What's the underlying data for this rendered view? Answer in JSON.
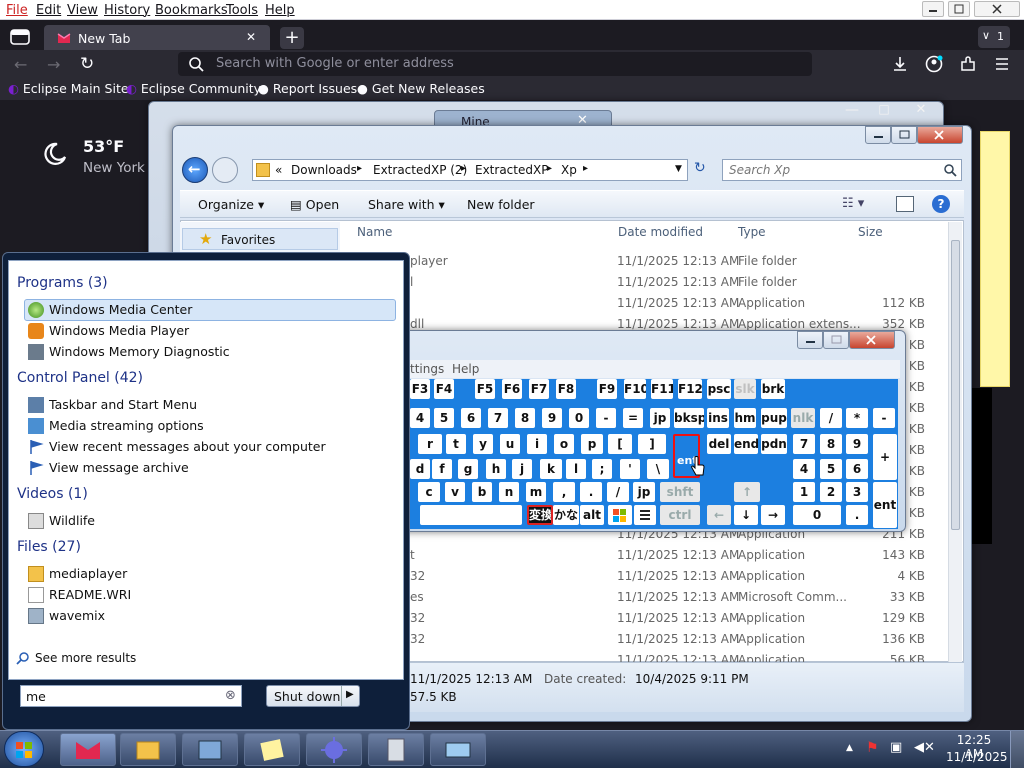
{
  "firefox": {
    "menubar": [
      "File",
      "Edit",
      "View",
      "History",
      "Bookmarks",
      "Tools",
      "Help"
    ],
    "tab": {
      "title": "New Tab",
      "close": "✕"
    },
    "tab_count_badge": "1",
    "search_placeholder": "Search with Google or enter address",
    "bookmarks": [
      "Eclipse Main Site",
      "Eclipse Community",
      "Report Issues",
      "Get New Releases"
    ],
    "weather": {
      "temp": "53°F",
      "city": "New York"
    }
  },
  "background_window_title": "Mine",
  "explorer": {
    "breadcrumb": {
      "prefix": "«",
      "items": [
        "Downloads",
        "ExtractedXP (2)",
        "ExtractedXP",
        "Xp"
      ]
    },
    "search_placeholder": "Search Xp",
    "toolbar": {
      "organize": "Organize",
      "open": "Open",
      "share": "Share with",
      "new_folder": "New folder"
    },
    "nav_favorites": "Favorites",
    "columns": [
      "Name",
      "Date modified",
      "Type",
      "Size"
    ],
    "rows": [
      {
        "name": "player",
        "date": "11/1/2025 12:13 AM",
        "type": "File folder",
        "size": ""
      },
      {
        "name": "l",
        "date": "11/1/2025 12:13 AM",
        "type": "File folder",
        "size": ""
      },
      {
        "name": "",
        "date": "11/1/2025 12:13 AM",
        "type": "Application",
        "size": "112 KB"
      },
      {
        "name": "dll",
        "date": "11/1/2025 12:13 AM",
        "type": "Application extens...",
        "size": "352 KB"
      },
      {
        "name": "rd",
        "date": "",
        "type": "",
        "size": "KB"
      },
      {
        "name": "",
        "date": "",
        "type": "",
        "size": "KB"
      },
      {
        "name": "",
        "date": "",
        "type": "",
        "size": "KB"
      },
      {
        "name": "",
        "date": "",
        "type": "",
        "size": "KB"
      },
      {
        "name": "",
        "date": "",
        "type": "",
        "size": "KB"
      },
      {
        "name": "",
        "date": "",
        "type": "",
        "size": "KB"
      },
      {
        "name": "",
        "date": "",
        "type": "",
        "size": "KB"
      },
      {
        "name": "",
        "date": "",
        "type": "",
        "size": "KB"
      },
      {
        "name": "",
        "date": "",
        "type": "",
        "size": "KB"
      },
      {
        "name": "",
        "date": "11/1/2025 12:13 AM",
        "type": "Application",
        "size": "211 KB"
      },
      {
        "name": "t",
        "date": "11/1/2025 12:13 AM",
        "type": "Application",
        "size": "143 KB"
      },
      {
        "name": "32",
        "date": "11/1/2025 12:13 AM",
        "type": "Application",
        "size": "4 KB"
      },
      {
        "name": "es",
        "date": "11/1/2025 12:13 AM",
        "type": "Microsoft Comm...",
        "size": "33 KB"
      },
      {
        "name": "32",
        "date": "11/1/2025 12:13 AM",
        "type": "Application",
        "size": "129 KB"
      },
      {
        "name": "32",
        "date": "11/1/2025 12:13 AM",
        "type": "Application",
        "size": "136 KB"
      },
      {
        "name": "",
        "date": "11/1/2025 12:13 AM",
        "type": "Application",
        "size": "56 KB"
      }
    ],
    "details": {
      "modified": "11/1/2025 12:13 AM",
      "created_label": "Date created:",
      "created": "10/4/2025 9:11 PM",
      "size": "57.5 KB"
    }
  },
  "osk": {
    "menu": [
      "ttings",
      "Help"
    ],
    "rows": [
      [
        "F3",
        "F4",
        "F5",
        "F6",
        "F7",
        "F8",
        "F9",
        "F10",
        "F11",
        "F12",
        "psc",
        "slk",
        "brk"
      ],
      [
        "4",
        "5",
        "6",
        "7",
        "8",
        "9",
        "0",
        "-",
        "=",
        "jp",
        "bksp",
        "ins",
        "hm",
        "pup",
        "nlk",
        "/",
        "*",
        "-"
      ],
      [
        "r",
        "t",
        "y",
        "u",
        "i",
        "o",
        "p",
        "[",
        "]",
        "ent",
        "del",
        "end",
        "pdn",
        "7",
        "8",
        "9",
        "+"
      ],
      [
        "d",
        "f",
        "g",
        "h",
        "j",
        "k",
        "l",
        ";",
        "'",
        "\\",
        "4",
        "5",
        "6"
      ],
      [
        "c",
        "v",
        "b",
        "n",
        "m",
        ",",
        ".",
        "/",
        "jp",
        "shft",
        "↑",
        "1",
        "2",
        "3",
        "ent"
      ],
      [
        "変換",
        "かな",
        "alt",
        "ctrl",
        "←",
        "↓",
        "→",
        "0",
        "."
      ]
    ]
  },
  "start_menu": {
    "groups": [
      {
        "title": "Programs (3)",
        "items": [
          "Windows Media Center",
          "Windows Media Player",
          "Windows Memory Diagnostic"
        ]
      },
      {
        "title": "Control Panel (42)",
        "items": [
          "Taskbar and Start Menu",
          "Media streaming options",
          "View recent messages about your computer",
          "View message archive"
        ]
      },
      {
        "title": "Videos (1)",
        "items": [
          "Wildlife"
        ]
      },
      {
        "title": "Files (27)",
        "items": [
          "mediaplayer",
          "README.WRI",
          "wavemix"
        ]
      }
    ],
    "see_more": "See more results",
    "search_value": "me",
    "shutdown": "Shut down"
  },
  "taskbar": {
    "time": "12:25 AM",
    "date": "11/1/2025"
  },
  "colors": {
    "osk_blue": "#1c7fe0",
    "selection": "#cfe3f9",
    "firefox_dark": "#1c1b22",
    "start_heading": "#1e3287"
  }
}
